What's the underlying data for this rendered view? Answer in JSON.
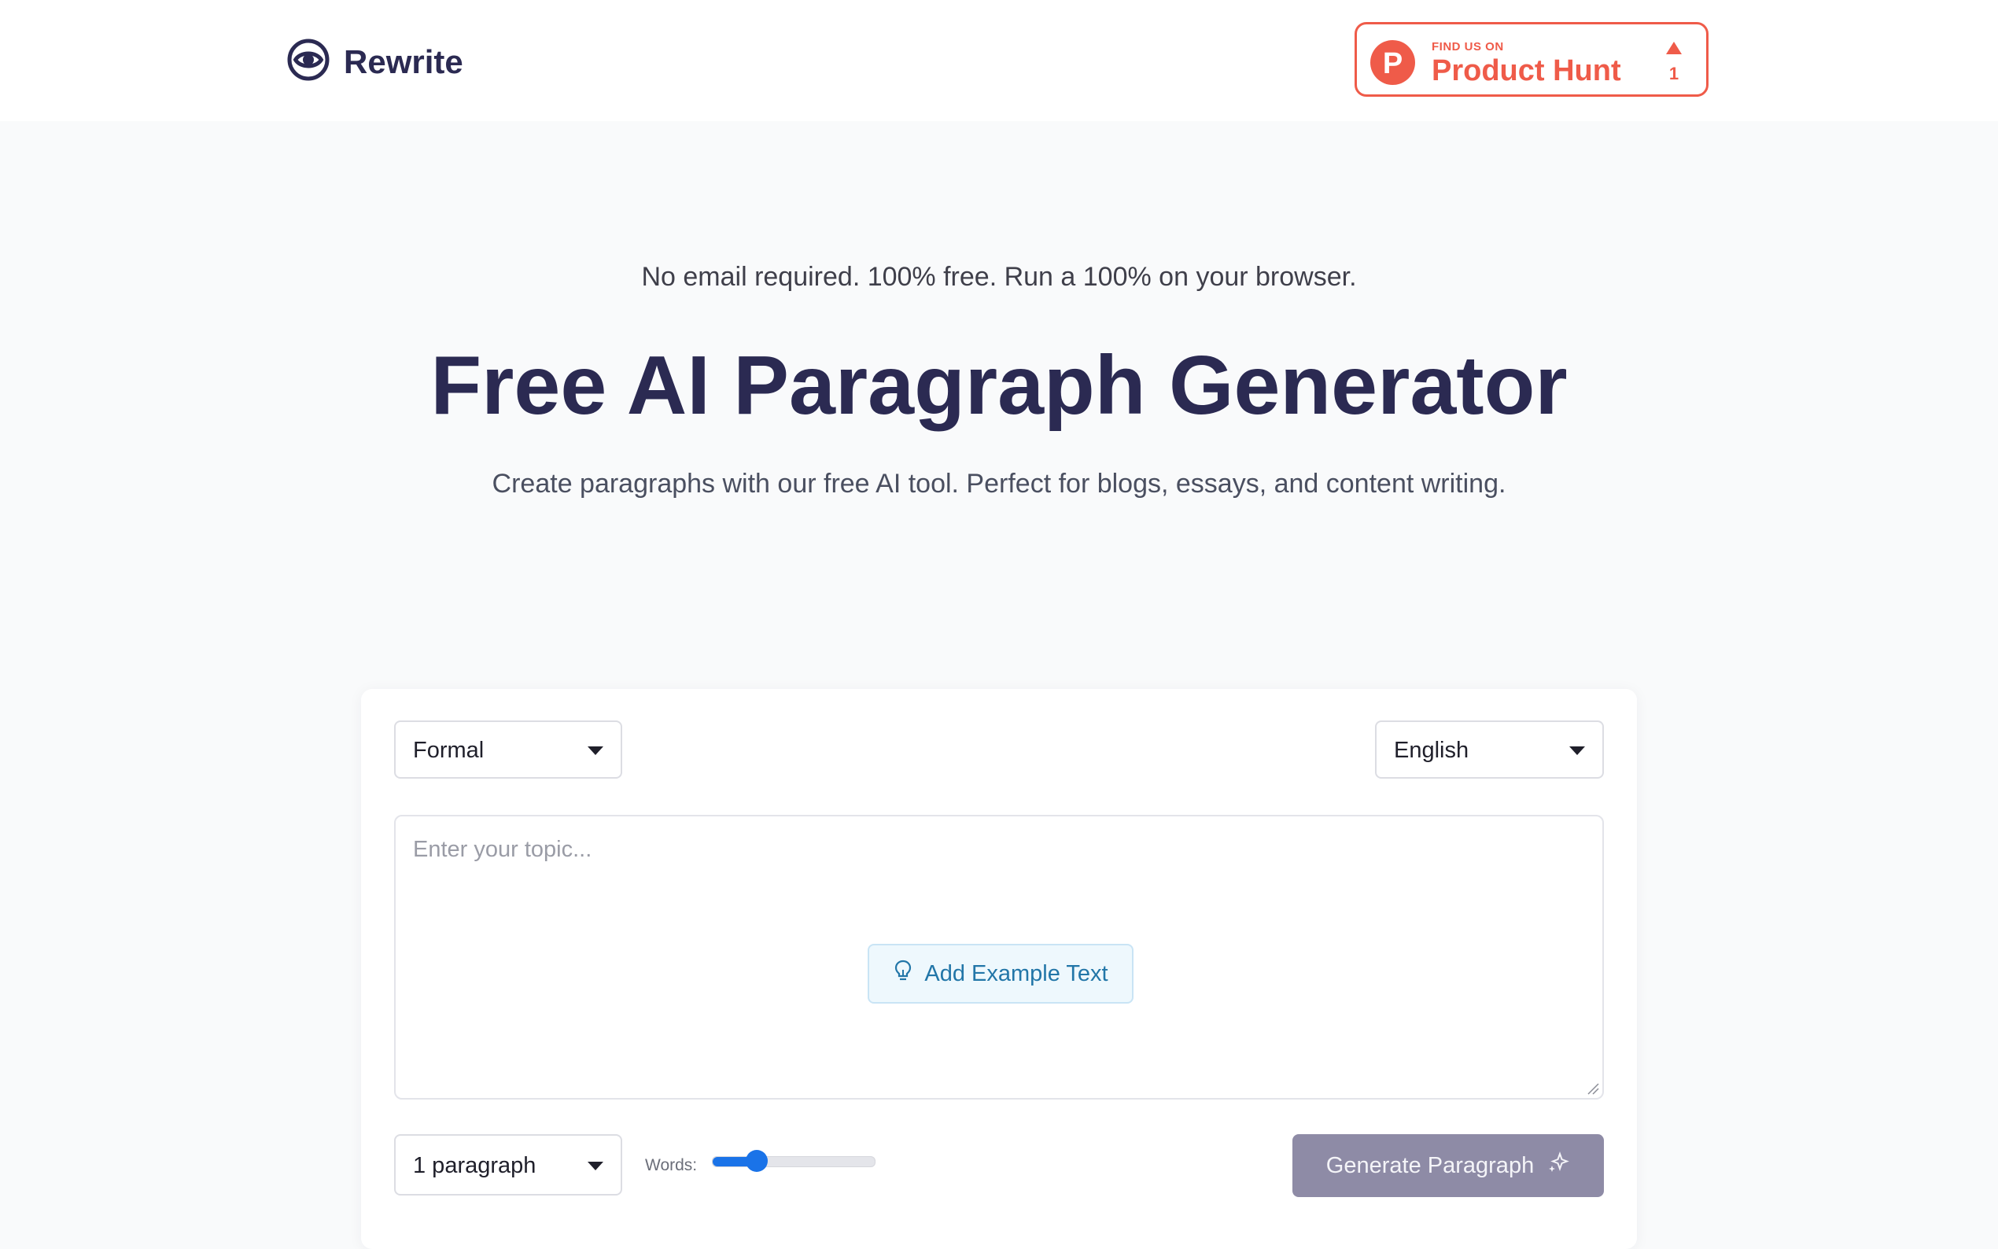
{
  "header": {
    "logo_text": "Rewrite",
    "logo_icon": "rewrite-logo-icon",
    "product_hunt": {
      "small_label": "FIND US ON",
      "big_label": "Product Hunt",
      "letter": "P",
      "upvotes": "1"
    }
  },
  "hero": {
    "tagline": "No email required. 100% free. Run a 100% on your browser.",
    "title": "Free AI Paragraph Generator",
    "subtitle": "Create paragraphs with our free AI tool. Perfect for blogs, essays, and content writing."
  },
  "form": {
    "tone_select": {
      "value": "Formal"
    },
    "language_select": {
      "value": "English"
    },
    "topic_input": {
      "placeholder": "Enter your topic...",
      "value": ""
    },
    "example_button": {
      "label": "Add Example Text",
      "icon": "lightbulb-icon"
    },
    "paragraph_count_select": {
      "value": "1 paragraph"
    },
    "words_label": "Words:",
    "words_slider_level": 0.27,
    "generate_button": {
      "label": "Generate Paragraph",
      "icon": "sparkle-icon"
    }
  },
  "colors": {
    "brand_text": "#2b2a52",
    "product_hunt": "#ef5b49",
    "slider_accent": "#1a73e8",
    "generate_button_bg": "#8e8ba6",
    "example_button_text": "#2276a8"
  }
}
